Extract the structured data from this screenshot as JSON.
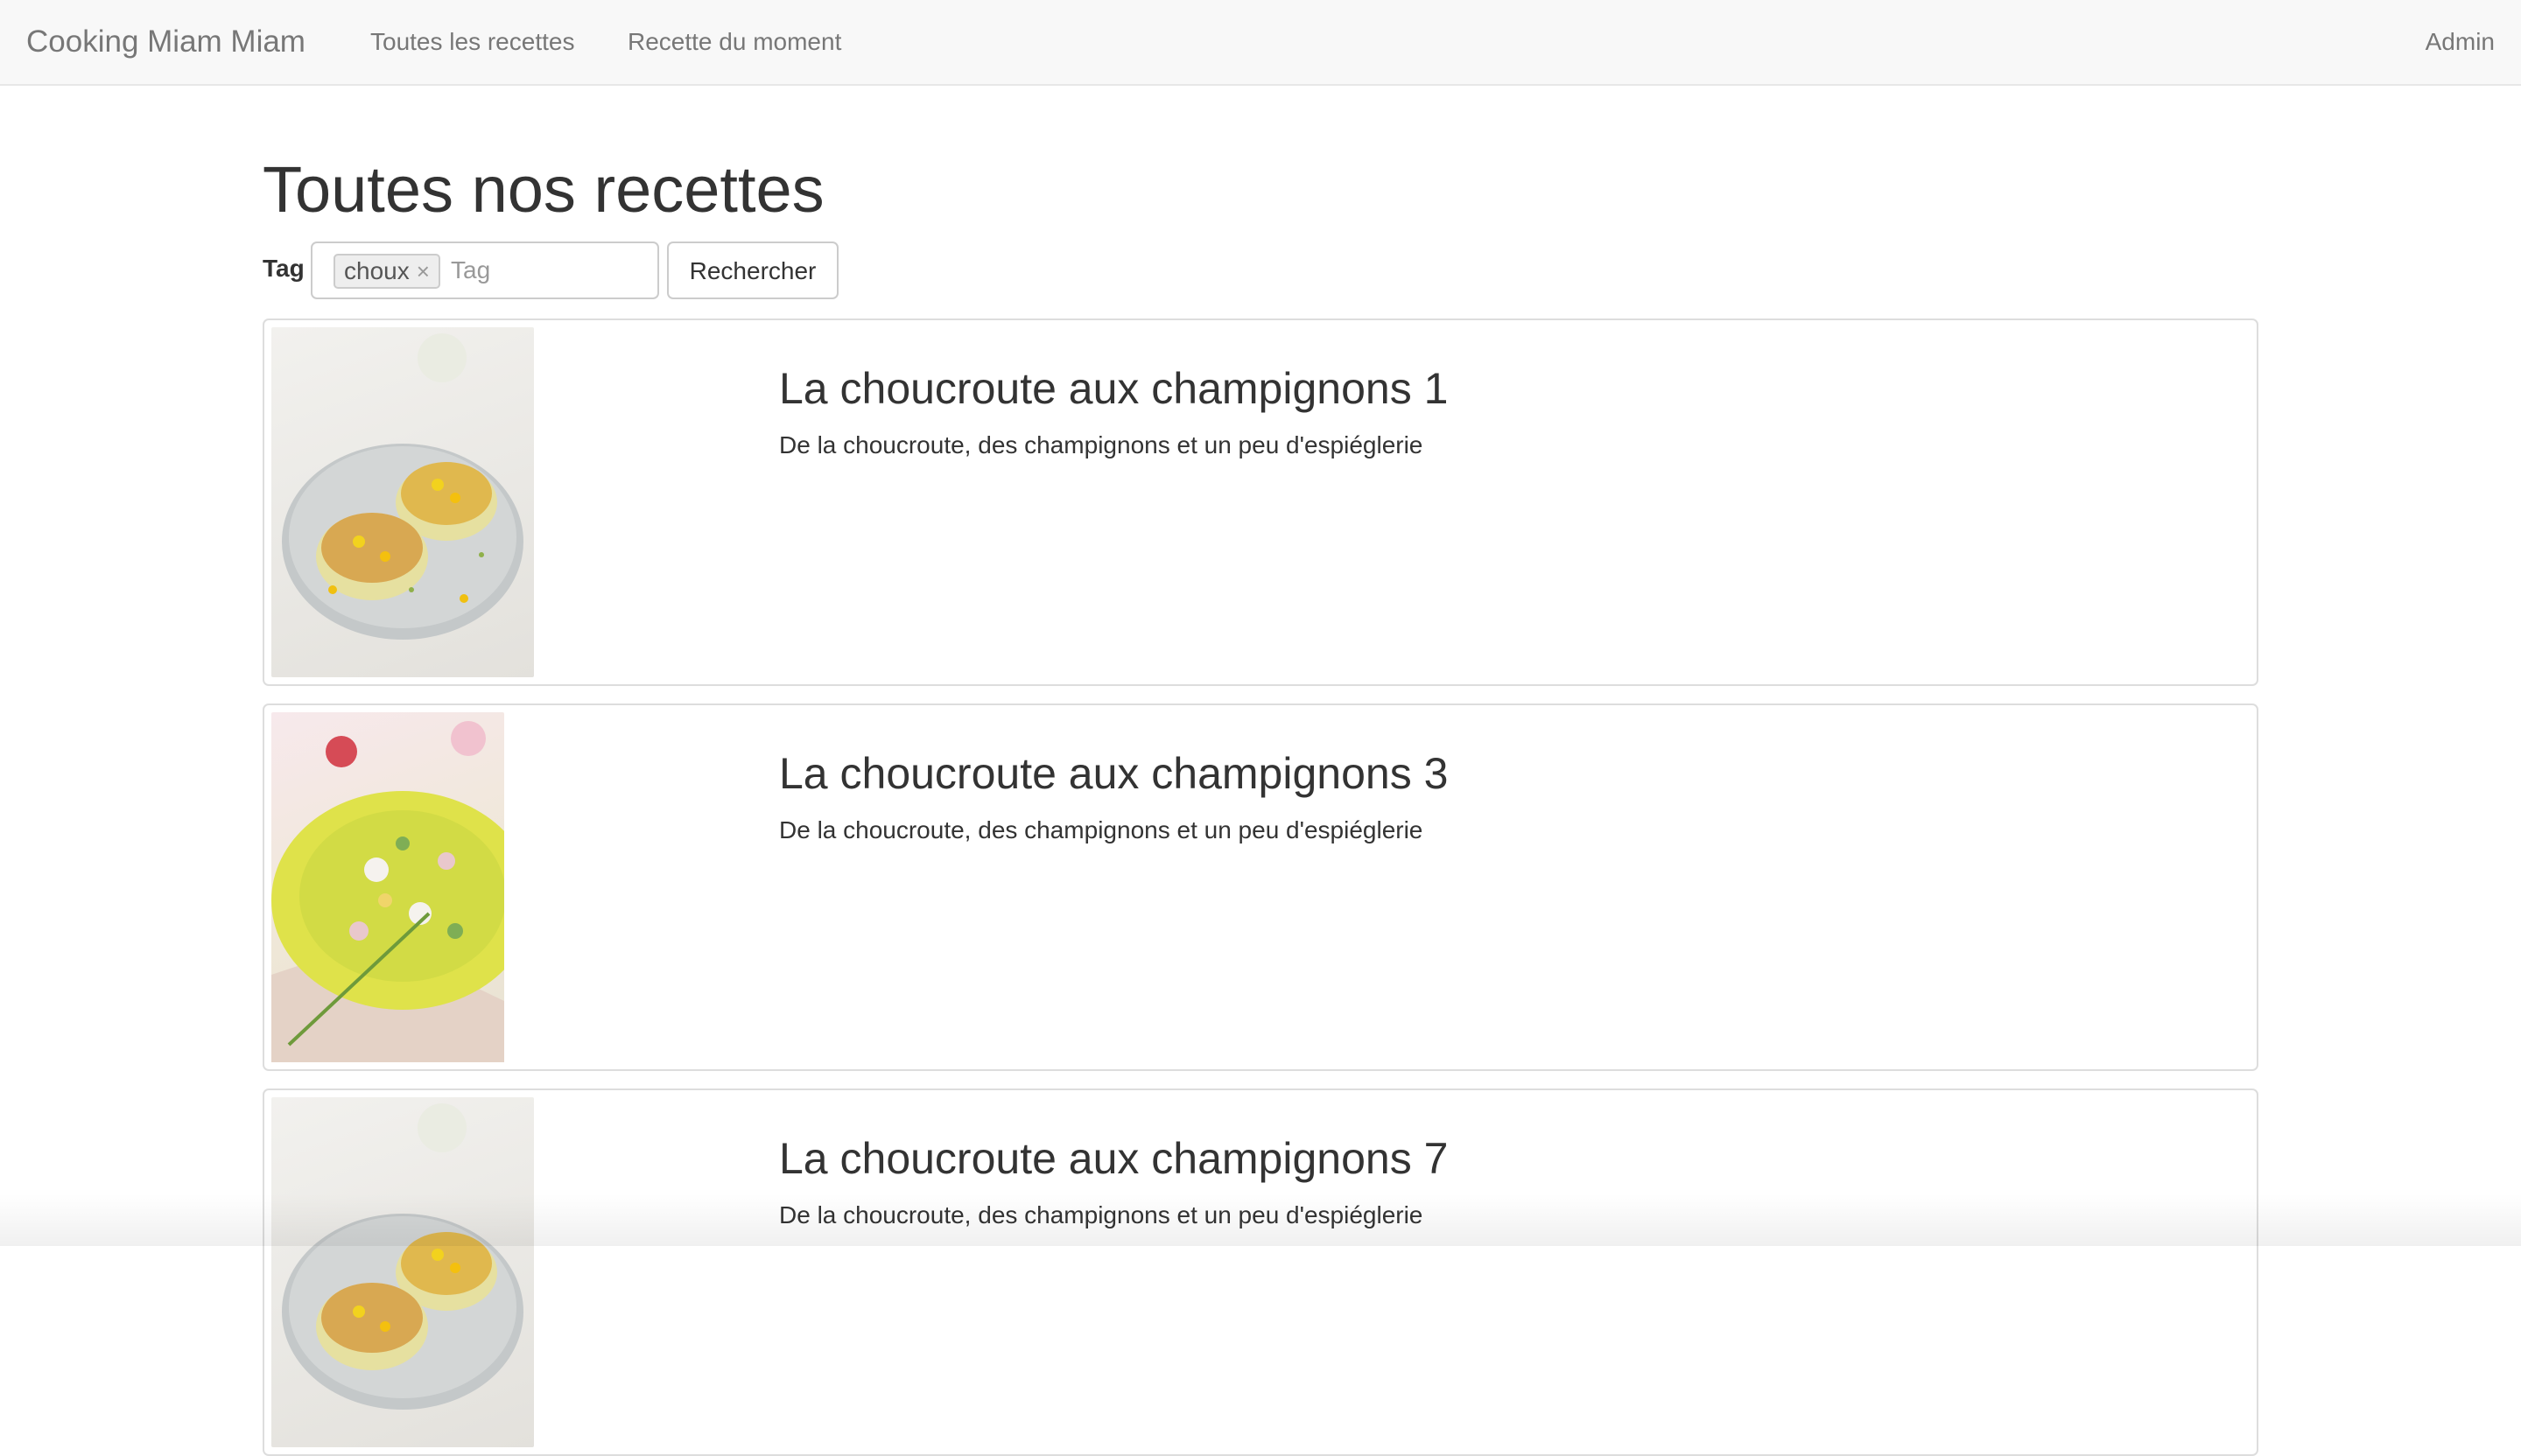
{
  "navbar": {
    "brand": "Cooking Miam Miam",
    "links": [
      "Toutes les recettes",
      "Recette du moment"
    ],
    "admin": "Admin"
  },
  "page": {
    "title": "Toutes nos recettes"
  },
  "search": {
    "tag_label": "Tag",
    "active_tag": "choux",
    "remove_glyph": "×",
    "placeholder": "Tag",
    "button_label": "Rechercher"
  },
  "recipes": [
    {
      "title": "La choucroute aux champignons 1",
      "description": "De la choucroute, des champignons et un peu d'espiéglerie"
    },
    {
      "title": "La choucroute aux champignons 3",
      "description": "De la choucroute, des champignons et un peu d'espiéglerie"
    },
    {
      "title": "La choucroute aux champignons 7",
      "description": "De la choucroute, des champignons et un peu d'espiéglerie"
    }
  ]
}
